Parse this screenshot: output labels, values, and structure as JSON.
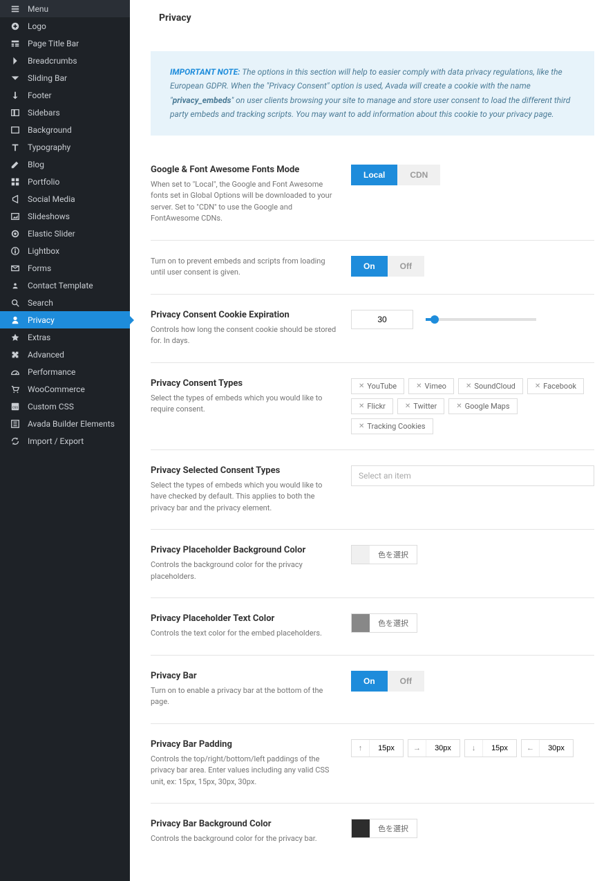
{
  "sidebar": [
    {
      "icon": "menu",
      "label": "Menu"
    },
    {
      "icon": "plus-circle",
      "label": "Logo"
    },
    {
      "icon": "titlebar",
      "label": "Page Title Bar"
    },
    {
      "icon": "chevron-right",
      "label": "Breadcrumbs"
    },
    {
      "icon": "chevron-down",
      "label": "Sliding Bar"
    },
    {
      "icon": "down-arrow",
      "label": "Footer"
    },
    {
      "icon": "sidebar",
      "label": "Sidebars"
    },
    {
      "icon": "background",
      "label": "Background"
    },
    {
      "icon": "typography",
      "label": "Typography"
    },
    {
      "icon": "edit",
      "label": "Blog"
    },
    {
      "icon": "grid",
      "label": "Portfolio"
    },
    {
      "icon": "share",
      "label": "Social Media"
    },
    {
      "icon": "image",
      "label": "Slideshows"
    },
    {
      "icon": "slider",
      "label": "Elastic Slider"
    },
    {
      "icon": "info",
      "label": "Lightbox"
    },
    {
      "icon": "mail",
      "label": "Forms"
    },
    {
      "icon": "contact",
      "label": "Contact Template"
    },
    {
      "icon": "search",
      "label": "Search"
    },
    {
      "icon": "user",
      "label": "Privacy",
      "active": true
    },
    {
      "icon": "star",
      "label": "Extras"
    },
    {
      "icon": "puzzle",
      "label": "Advanced"
    },
    {
      "icon": "gauge",
      "label": "Performance"
    },
    {
      "icon": "cart",
      "label": "WooCommerce"
    },
    {
      "icon": "css",
      "label": "Custom CSS"
    },
    {
      "icon": "builder",
      "label": "Avada Builder Elements"
    },
    {
      "icon": "refresh",
      "label": "Import / Export"
    }
  ],
  "page_title": "Privacy",
  "note": {
    "title": "IMPORTANT NOTE:",
    "text1": " The options in this section will help to easier comply with data privacy regulations, like the European GDPR. When the \"Privacy Consent\" option is used, Avada will create a cookie with the name \"",
    "bold": "privacy_embeds",
    "text2": "\" on user clients browsing your site to manage and store user consent to load the different third party embeds and tracking scripts. You may want to add information about this cookie to your privacy page."
  },
  "opts": {
    "fonts": {
      "title": "Google & Font Awesome Fonts Mode",
      "desc": "When set to \"Local\", the Google and Font Awesome fonts set in Global Options will be downloaded to your server. Set to \"CDN\" to use the Google and FontAwesome CDNs.",
      "a": "Local",
      "b": "CDN"
    },
    "consent": {
      "desc": "Turn on to prevent embeds and scripts from loading until user consent is given.",
      "a": "On",
      "b": "Off"
    },
    "expire": {
      "title": "Privacy Consent Cookie Expiration",
      "desc": "Controls how long the consent cookie should be stored for. In days.",
      "value": "30"
    },
    "types": {
      "title": "Privacy Consent Types",
      "desc": "Select the types of embeds which you would like to require consent.",
      "tags": [
        "YouTube",
        "Vimeo",
        "SoundCloud",
        "Facebook",
        "Flickr",
        "Twitter",
        "Google Maps",
        "Tracking Cookies"
      ]
    },
    "selected_types": {
      "title": "Privacy Selected Consent Types",
      "desc": "Select the types of embeds which you would like to have checked by default. This applies to both the privacy bar and the privacy element.",
      "placeholder": "Select an item"
    },
    "ph_bg": {
      "title": "Privacy Placeholder Background Color",
      "desc": "Controls the background color for the privacy placeholders.",
      "swatch": "#f0f0f0",
      "btn": "色を選択"
    },
    "ph_text": {
      "title": "Privacy Placeholder Text Color",
      "desc": "Controls the text color for the embed placeholders.",
      "swatch": "#888888",
      "btn": "色を選択"
    },
    "bar": {
      "title": "Privacy Bar",
      "desc": "Turn on to enable a privacy bar at the bottom of the page.",
      "a": "On",
      "b": "Off"
    },
    "bar_pad": {
      "title": "Privacy Bar Padding",
      "desc": "Controls the top/right/bottom/left paddings of the privacy bar area. Enter values including any valid CSS unit, ex: 15px, 15px, 30px, 30px.",
      "vals": [
        "15px",
        "30px",
        "15px",
        "30px"
      ]
    },
    "bar_bg": {
      "title": "Privacy Bar Background Color",
      "desc": "Controls the background color for the privacy bar.",
      "swatch": "#2d2d2d",
      "btn": "色を選択"
    }
  }
}
